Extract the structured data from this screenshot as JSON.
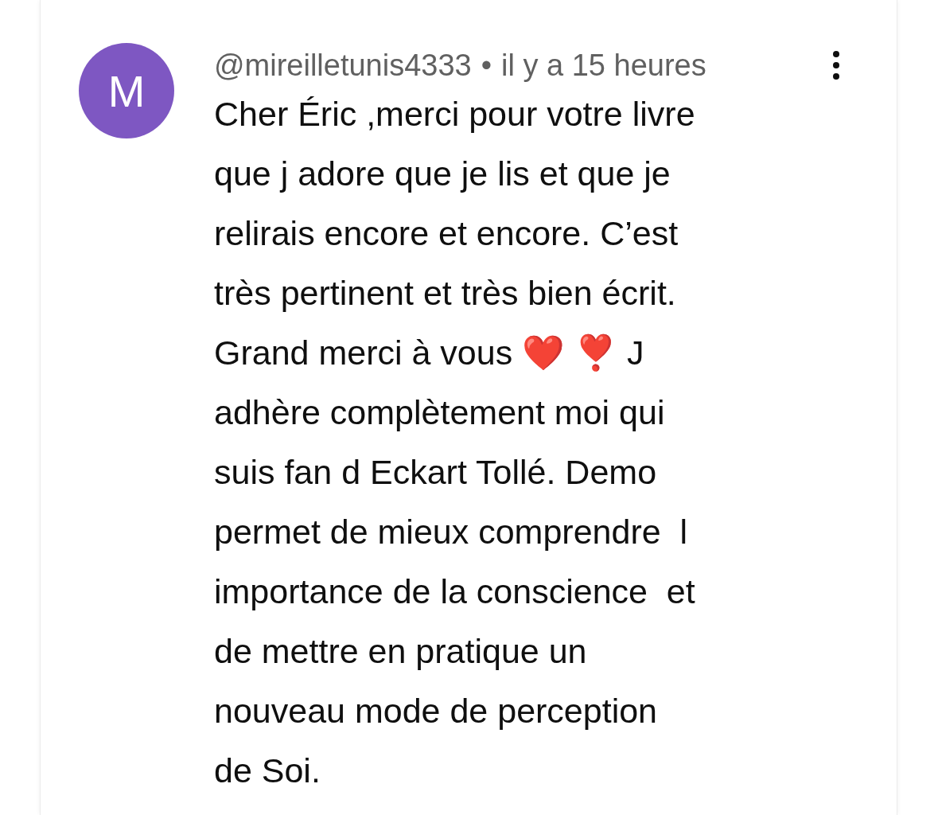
{
  "comment": {
    "avatar_letter": "M",
    "author": "@mireilletunis4333",
    "separator": "•",
    "time": "il y a 15 heures",
    "text": "Cher Éric ,merci pour votre livre\nque j adore que je lis et que je\nrelirais encore et encore. C’est\ntrès pertinent et très bien écrit.\nGrand merci à vous ❤️ ❣️ J\nadhère complètement moi qui\nsuis fan d Eckart Tollé. Demo\npermet de mieux comprendre  l\nimportance de la conscience  et\nde mettre en pratique un\nnouveau mode de perception\nde Soi."
  }
}
